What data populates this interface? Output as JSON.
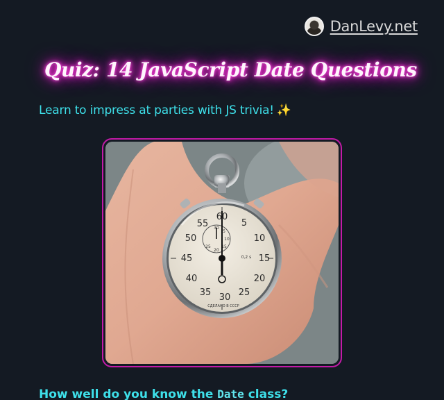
{
  "header": {
    "site_name": "DanLevy.net"
  },
  "article": {
    "title": "Quiz: 14 JavaScript Date Questions",
    "subtitle": "Learn to impress at parties with JS trivia!",
    "subtitle_emoji": "✨",
    "hero_alt": "Hand holding a stopwatch",
    "stopwatch": {
      "outer_numbers": [
        "60",
        "5",
        "10",
        "15",
        "20",
        "25",
        "30",
        "35",
        "40",
        "45",
        "50",
        "55"
      ],
      "inner_numbers": [
        "30",
        "5",
        "10",
        "15",
        "20",
        "25"
      ],
      "dial_text": "0,2 s",
      "maker_text": "СДЕЛАНО В СССР"
    },
    "next_heading_prefix": "How well do you know the ",
    "next_heading_code": "Date",
    "next_heading_suffix": " class?"
  },
  "colors": {
    "background": "#141a23",
    "accent_cyan": "#3ee0ea",
    "neon_pink": "#ff2ad4",
    "frame_border": "#c31aa8"
  }
}
